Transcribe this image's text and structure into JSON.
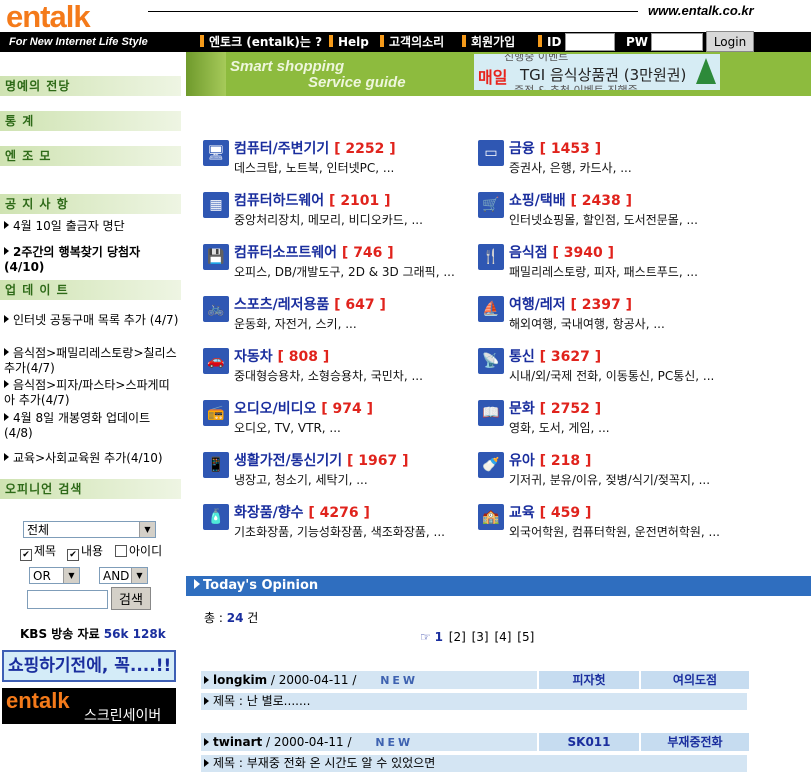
{
  "header": {
    "logo": "entalk",
    "tagline": "For New Internet Life Style",
    "site_url": "www.entalk.co.kr",
    "nav": [
      "엔토크 (entalk)는 ?",
      "Help",
      "고객의소리",
      "회원가입"
    ],
    "id_label": "ID",
    "pw_label": "PW",
    "login_label": "Login",
    "accent": "#f47a1a"
  },
  "banner": {
    "line1": "Smart shopping",
    "line2": "Service guide",
    "ad_top": "진행중 이벤트",
    "ad_hot": "매일",
    "ad_main": "TGI 음식상품권 (3만원권)",
    "ad_bottom": "증정 & 추첨 이벤트 진행중"
  },
  "sidebar": {
    "menu": [
      "명예의 전당",
      "통    계",
      "엔 조 모"
    ],
    "notice_head": "공 지 사 항",
    "notices": [
      "4월 10일 출금자 명단",
      "2주간의 행복찾기 당첨자 (4/10)"
    ],
    "update_head": "업 데 이 트",
    "updates": [
      "인터넷 공동구매 목록 추가 (4/7)",
      "음식점>패밀리레스토랑>칠리스 추가(4/7)",
      "음식점>피자/파스타>스파게띠아 추가(4/7)",
      "4월 8일 개봉영화 업데이트 (4/8)",
      "교육>사회교육원 추가(4/10)"
    ],
    "search_head": "오피니언 검색",
    "search": {
      "scope": "전체",
      "checks": [
        {
          "label": "제목",
          "checked": true
        },
        {
          "label": "내용",
          "checked": true
        },
        {
          "label": "아이디",
          "checked": false
        }
      ],
      "op1": "OR",
      "op2": "AND",
      "button": "검색"
    },
    "kbs_label": "KBS 방송 자료",
    "kbs_56k": "56k",
    "kbs_128k": "128k",
    "shop_banner": "쇼핑하기전에, 꼭....!!",
    "saver_logo": "entalk",
    "saver_text": "스크린세이버"
  },
  "categories": [
    {
      "icon": "monitor-icon",
      "glyph": "🖥",
      "title": "컴퓨터/주변기기",
      "count": "[ 2252 ]",
      "sub": "데스크탑, 노트북, 인터넷PC, ..."
    },
    {
      "icon": "card-icon",
      "glyph": "▭",
      "title": "금융",
      "count": "[ 1453 ]",
      "sub": "증권사, 은행, 카드사, ..."
    },
    {
      "icon": "chip-icon",
      "glyph": "▦",
      "title": "컴퓨터하드웨어",
      "count": "[ 2101 ]",
      "sub": "중앙처리장치, 메모리, 비디오카드, ..."
    },
    {
      "icon": "cart-icon",
      "glyph": "🛒",
      "title": "쇼핑/택배",
      "count": "[ 2438 ]",
      "sub": "인터넷쇼핑몰, 할인점, 도서전문몰, ..."
    },
    {
      "icon": "floppy-icon",
      "glyph": "💾",
      "title": "컴퓨터소프트웨어",
      "count": "[ 746 ]",
      "sub": "오피스, DB/개발도구, 2D & 3D 그래픽, ..."
    },
    {
      "icon": "fork-knife-icon",
      "glyph": "🍴",
      "title": "음식점",
      "count": "[ 3940 ]",
      "sub": "패밀리레스토랑, 피자, 패스트푸드, ..."
    },
    {
      "icon": "bicycle-icon",
      "glyph": "🚲",
      "title": "스포츠/레저용품",
      "count": "[ 647 ]",
      "sub": "운동화, 자전거, 스키, ..."
    },
    {
      "icon": "sailboat-icon",
      "glyph": "⛵",
      "title": "여행/레저",
      "count": "[ 2397 ]",
      "sub": "해외여행, 국내여행, 항공사, ..."
    },
    {
      "icon": "car-icon",
      "glyph": "🚗",
      "title": "자동차",
      "count": "[ 808 ]",
      "sub": "중대형승용차, 소형승용차, 국민차, ..."
    },
    {
      "icon": "satellite-dish-icon",
      "glyph": "📡",
      "title": "통신",
      "count": "[ 3627 ]",
      "sub": "시내/외/국제 전화, 이동통신, PC통신, ..."
    },
    {
      "icon": "stereo-icon",
      "glyph": "📻",
      "title": "오디오/비디오",
      "count": "[ 974 ]",
      "sub": "오디오, TV, VTR, ..."
    },
    {
      "icon": "book-icon",
      "glyph": "📖",
      "title": "문화",
      "count": "[ 2752 ]",
      "sub": "영화, 도서, 게임, ..."
    },
    {
      "icon": "phone-icon",
      "glyph": "📱",
      "title": "생활가전/통신기기",
      "count": "[ 1967 ]",
      "sub": "냉장고, 청소기, 세탁기, ..."
    },
    {
      "icon": "baby-bottle-icon",
      "glyph": "🍼",
      "title": "유아",
      "count": "[ 218 ]",
      "sub": "기저귀, 분유/이유, 젖병/식기/젖꼭지, ..."
    },
    {
      "icon": "perfume-icon",
      "glyph": "🧴",
      "title": "화장품/향수",
      "count": "[ 4276 ]",
      "sub": "기초화장품, 기능성화장품, 색조화장품, ..."
    },
    {
      "icon": "school-icon",
      "glyph": "🏫",
      "title": "교육",
      "count": "[ 459 ]",
      "sub": "외국어학원, 컴퓨터학원, 운전면허학원, ..."
    }
  ],
  "opinion": {
    "title": "Today's Opinion",
    "total_prefix": "총 : ",
    "total_count": "24",
    "total_suffix": " 건",
    "pages": [
      "1",
      "[2]",
      "[3]",
      "[4]",
      "[5]"
    ],
    "new_badge": "NEW",
    "posts": [
      {
        "user": "longkim",
        "date": " / 2000-04-11 / ",
        "tag1": "피자헛",
        "tag2": "여의도점",
        "subject": "제목 : 난 별로......."
      },
      {
        "user": "twinart",
        "date": " / 2000-04-11 / ",
        "tag1": "SK011",
        "tag2": "부재중전화",
        "subject": "제목 : 부재중 전화 온 시간도 알 수 있었으면"
      }
    ]
  }
}
